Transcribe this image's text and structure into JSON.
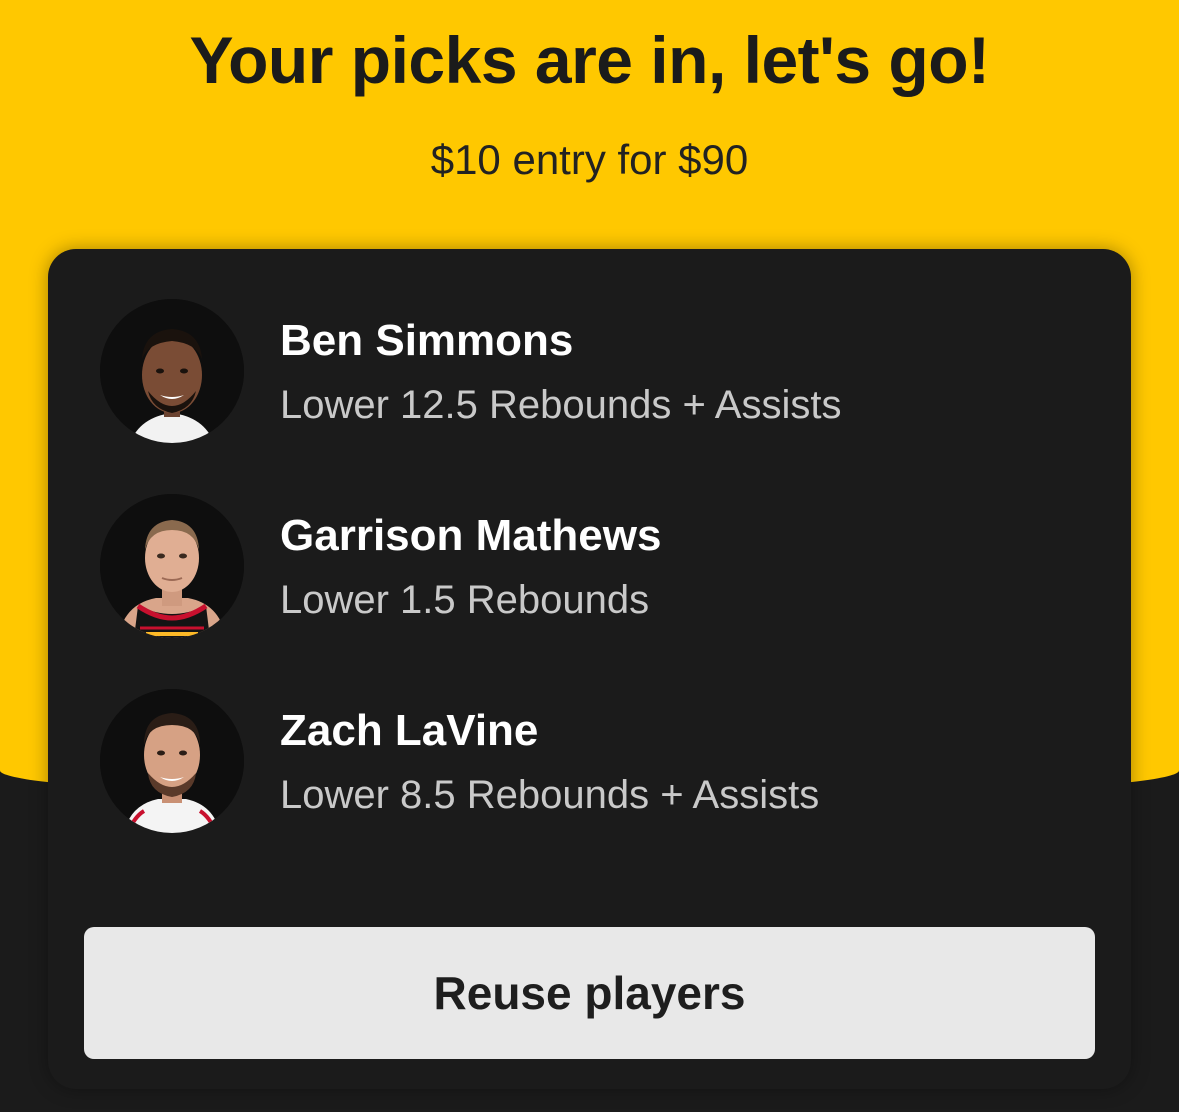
{
  "header": {
    "title": "Your picks are in, let's go!",
    "subtitle": "$10 entry for $90"
  },
  "picks": [
    {
      "player": "Ben Simmons",
      "line": "Lower 12.5 Rebounds + Assists",
      "avatar": "player-headshot"
    },
    {
      "player": "Garrison Mathews",
      "line": "Lower 1.5 Rebounds",
      "avatar": "player-headshot"
    },
    {
      "player": "Zach LaVine",
      "line": "Lower 8.5 Rebounds + Assists",
      "avatar": "player-headshot"
    }
  ],
  "actions": {
    "reuse_label": "Reuse players"
  },
  "colors": {
    "accent": "#ffc800",
    "background": "#1b1b1b",
    "card": "#1b1b1b",
    "button": "#e8e8e8"
  }
}
